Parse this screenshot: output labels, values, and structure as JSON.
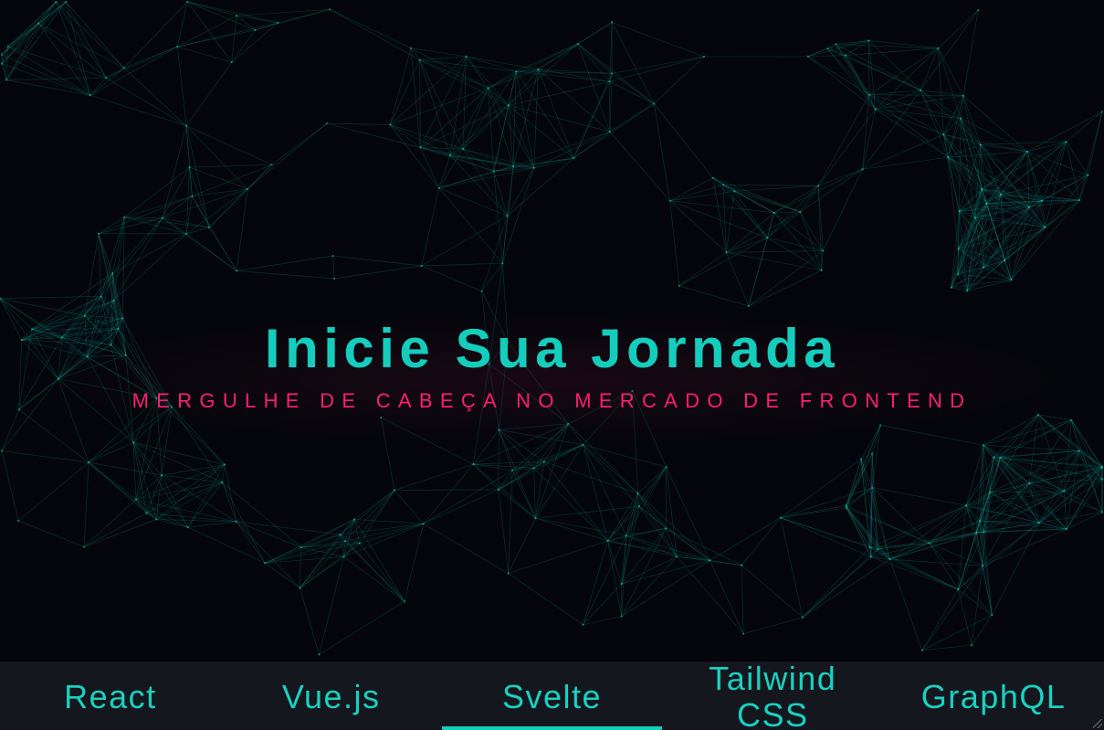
{
  "hero": {
    "title": "Inicie Sua Jornada",
    "subtitle": "MERGULHE DE CABEÇA NO MERCADO DE FRONTEND"
  },
  "tabs": [
    {
      "label": "React",
      "active": false
    },
    {
      "label": "Vue.js",
      "active": false
    },
    {
      "label": "Svelte",
      "active": true
    },
    {
      "label": "Tailwind CSS",
      "active": false
    },
    {
      "label": "GraphQL",
      "active": false
    }
  ],
  "colors": {
    "background": "#05060b",
    "accent": "#14cdbd",
    "subtitle": "#ff1f6f",
    "tabbar": "#15171e"
  },
  "icons": {
    "background": "particle-network",
    "grip": "resize-grip-icon"
  }
}
